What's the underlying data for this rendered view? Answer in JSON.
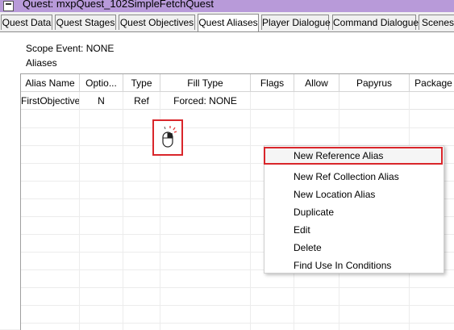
{
  "window": {
    "title": "Quest: mxpQuest_102SimpleFetchQuest"
  },
  "tabs": [
    {
      "label": "Quest Data"
    },
    {
      "label": "Quest Stages"
    },
    {
      "label": "Quest Objectives"
    },
    {
      "label": "Quest Aliases",
      "active": true
    },
    {
      "label": "Player Dialogue"
    },
    {
      "label": "Command Dialogue"
    },
    {
      "label": "Scenes"
    }
  ],
  "panel": {
    "scope_event": "Scope Event: NONE",
    "aliases_label": "Aliases"
  },
  "grid": {
    "columns": [
      "Alias Name",
      "Optio...",
      "Type",
      "Fill Type",
      "Flags",
      "Allow",
      "Papyrus",
      "Package"
    ],
    "rows": [
      [
        "FirstObjective",
        "N",
        "Ref",
        "Forced: NONE",
        "",
        "",
        "",
        ""
      ]
    ]
  },
  "context_menu": {
    "items": [
      "New Reference Alias",
      "New Ref Collection Alias",
      "New Location Alias",
      "Duplicate",
      "Edit",
      "Delete",
      "Find Use In Conditions"
    ],
    "highlighted": "New Reference Alias"
  },
  "icons": {
    "cursor": "mouse-right-click-icon",
    "app": "window-app-icon"
  },
  "colors": {
    "titlebar": "#b89ad9",
    "highlight_border": "#d9262b"
  }
}
